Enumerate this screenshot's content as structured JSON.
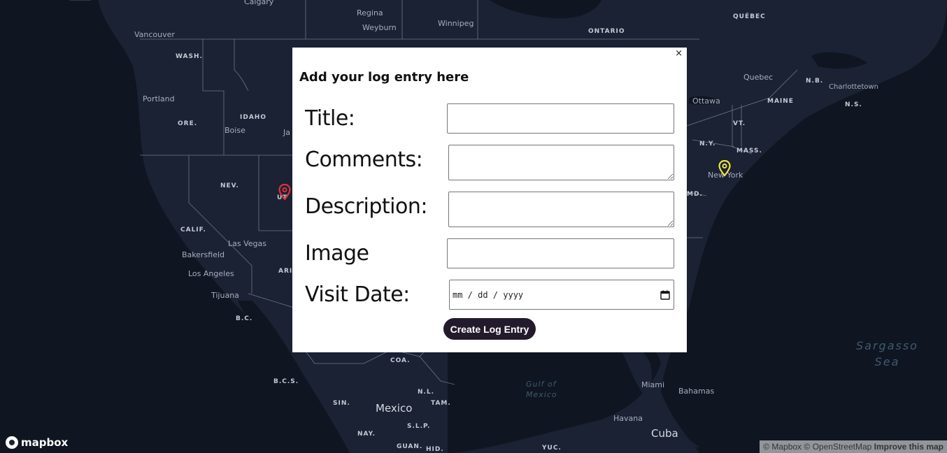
{
  "map": {
    "labels": {
      "calgary": "Calgary",
      "regina": "Regina",
      "weyburn": "Weyburn",
      "winnipeg": "Winnipeg",
      "ontario": "ONTARIO",
      "quebec_region": "QUÉBEC",
      "vancouver": "Vancouver",
      "wash": "WASH.",
      "portland": "Portland",
      "ore": "ORE.",
      "idaho": "IDAHO",
      "boise": "Boise",
      "ja": "Ja",
      "nev": "NEV.",
      "ut": "UT",
      "calif": "CALIF.",
      "las_vegas": "Las Vegas",
      "bakersfield": "Bakersfield",
      "los_angeles": "Los Angeles",
      "ari": "ARI",
      "tijuana": "Tijuana",
      "bc": "B.C.",
      "bcs": "B.C.S.",
      "sin": "SIN.",
      "mexico": "Mexico",
      "coa": "COA.",
      "nl": "N.L.",
      "tam": "TAM.",
      "slp": "S.L.P.",
      "nay": "NAY.",
      "guan": "GUAN.",
      "hid": "HID.",
      "yuc": "YUC.",
      "gulf_of_mexico": "Gulf of\nMexico",
      "miami": "Miami",
      "bahamas": "Bahamas",
      "havana": "Havana",
      "cuba": "Cuba",
      "sargasso_sea": "Sargasso\nSea",
      "quebec_city": "Quebec",
      "nb": "N.B.",
      "charlottetown": "Charlottetown",
      "ns": "N.S.",
      "ottawa": "Ottawa",
      "maine": "MAINE",
      "vt": "VT.",
      "ny": "N.Y.",
      "mass": "MASS.",
      "new_york": "New York",
      "md": "MD."
    }
  },
  "logo": {
    "text": "mapbox"
  },
  "attribution": {
    "mapbox": "© Mapbox",
    "osm": "© OpenStreetMap",
    "improve": "Improve this map"
  },
  "popup": {
    "close": "×",
    "title": "Add your log entry here",
    "form": {
      "title_label": "Title:",
      "comments_label": "Comments:",
      "description_label": "Description:",
      "image_label": "Image",
      "visit_date_label": "Visit Date:",
      "date_placeholder": "mm / dd / yyyy",
      "submit_label": "Create Log Entry"
    }
  },
  "colors": {
    "map_background": "#1a2233",
    "button_background": "#231a2b",
    "marker_red": "#e0323c",
    "marker_yellow": "#f0e442"
  },
  "icons": {
    "marker_red": "map-pin-icon",
    "marker_yellow": "map-pin-icon",
    "calendar": "calendar-icon",
    "close": "close-icon"
  }
}
